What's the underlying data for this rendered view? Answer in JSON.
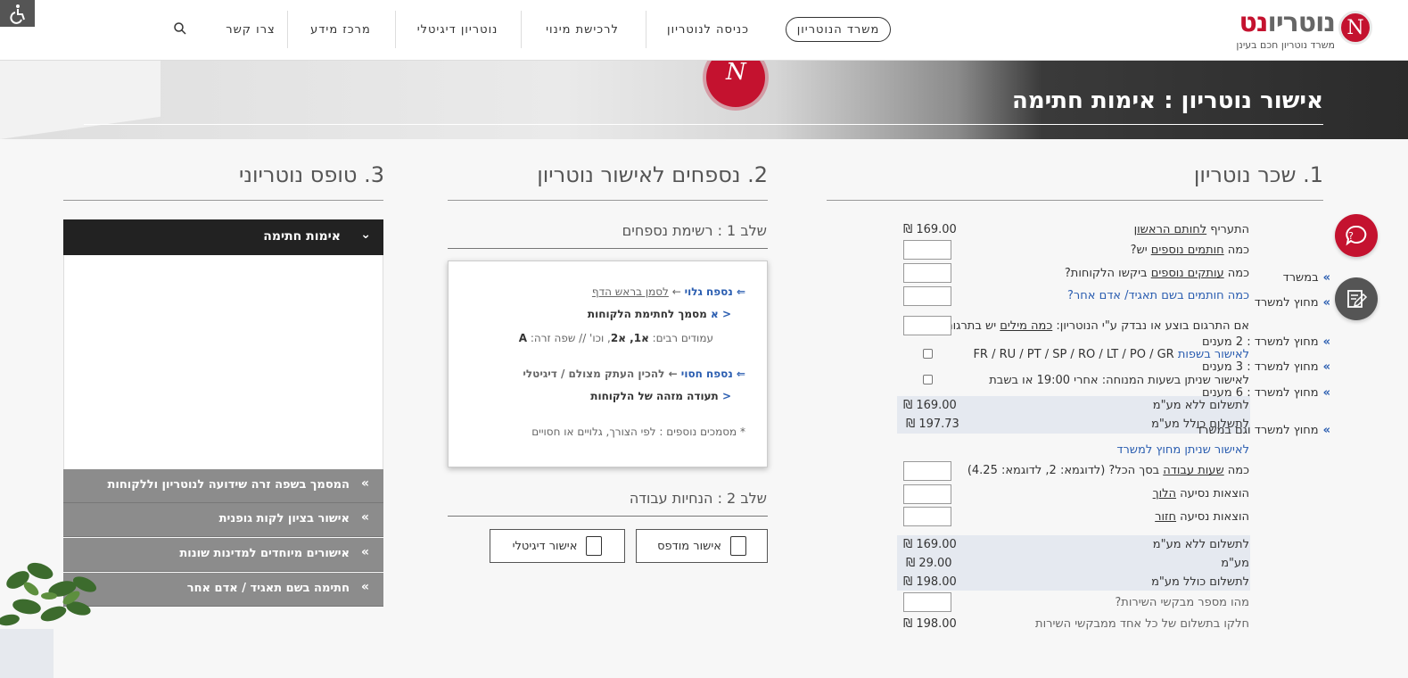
{
  "header": {
    "logo_main": "נוטריו",
    "logo_accent": "נט",
    "logo_sub": "משרד נוטריון חכם בעינן",
    "office_button": "משרד הנוטריון",
    "nav": [
      "כניסה לנוטריון",
      "לרכישת מינוי",
      "נוטריון דיגיטלי",
      "מרכז מידע",
      "צרו קשר"
    ]
  },
  "banner": {
    "title": "אישור נוטריון : אימות חתימה"
  },
  "col1": {
    "title": "1. שכר נוטריון",
    "rows": {
      "first_a": "התעריף ",
      "first_u": "לחותם הראשון",
      "first_val": "169.00 ₪",
      "signers_a": "כמה ",
      "signers_u": "חותמים נוספים",
      "signers_b": " יש?",
      "copies_a": "כמה ",
      "copies_u": "עותקים נוספים",
      "copies_b": " ביקשו הלקוחות?",
      "corp": "כמה חותמים בשם תאגיד/ אדם אחר?",
      "transl_a": "אם התרגום בוצע או נבדק ע\"י הנוטריון: ",
      "transl_u": "כמה מילים",
      "transl_b": " יש בתרגום?",
      "lang_a": "לאישור בשפות ",
      "lang_b": "FR / RU / PT / SP / RO / LT / PO / GR",
      "offhours": "לאישור שניתן בשעות המנוחה: אחרי 19:00 או בשבת",
      "pay_no_vat_1": "לתשלום ללא מע\"מ",
      "pay_no_vat_1_val": "169.00 ₪",
      "pay_vat_1": "לתשלום כולל מע\"מ",
      "pay_vat_1_val": "197.73 ₪",
      "outside": "לאישור שניתן מחוץ למשרד",
      "hours_a": "כמה ",
      "hours_u": "שעות עבודה",
      "hours_b": " בסך הכל? (לדוגמא: 2, לדוגמא: 4.25)",
      "travel_go_a": "הוצאות נסיעה ",
      "travel_go_u": "הלוך",
      "travel_back_a": "הוצאות נסיעה ",
      "travel_back_u": "חזור",
      "pay_no_vat_2": "לתשלום ללא מע\"מ",
      "pay_no_vat_2_val": "169.00 ₪",
      "vat": "מע\"מ",
      "vat_val": "29.00 ₪",
      "pay_vat_2": "לתשלום כולל מע\"מ",
      "pay_vat_2_val": "198.00 ₪",
      "requesters": "מהו מספר מבקשי השירות?",
      "split": "חלקו בתשלום של כל אחד ממבקשי השירות",
      "split_val": "198.00 ₪"
    }
  },
  "col2": {
    "title": "2. נספחים לאישור נוטריון",
    "step1": "שלב 1 : רשימת נספחים",
    "card": {
      "l1_a": "⇐ נספח גלוי",
      "l1_b": " ← ",
      "l1_c": "לסמן בראש הדף",
      "l2_a": "< א",
      "l2_b": " מסמך לחתימת הלקוחות",
      "l3": "עמודים רבים: ",
      "l3_b": "א1, א2",
      "l3_c": ", וכו' // שפה זרה: ",
      "l3_d": "A",
      "l4_a": "⇐ נספח חסוי",
      "l4_b": " ← להכין העתק מצולם / דיגיטלי",
      "l5_a": "<",
      "l5_b": " תעודה מזהה של הלקוחות",
      "l6": "* מסמכים נוספים : לפי הצורך, גלויים או חסויים"
    },
    "step2": "שלב 2 : הנחיות עבודה",
    "btn_printed": "אישור מודפס",
    "btn_digital": "אישור דיגיטלי"
  },
  "col3": {
    "title": "3. טופס נוטריוני",
    "accordion_open": "אימות חתימה",
    "items": [
      "במשרד",
      "מחוץ למשרד",
      "מחוץ למשרד : 2 מענים",
      "מחוץ למשרד : 3 מענים",
      "מחוץ למשרד : 6 מענים",
      "מחוץ למשרד וגם במשרד"
    ],
    "closed": [
      "המסמך בשפה זרה שידועה לנוטריון וללקוחות",
      "אישור בציון לקות גופנית",
      "אישורים מיוחדים למדינות שונות",
      "חתימה בשם תאגיד / אדם אחר"
    ]
  },
  "colors": {
    "brand_red": "#c4122f",
    "link_blue": "#2a5db0",
    "dark": "#222222"
  },
  "icons": [
    "accessibility-icon",
    "search-icon",
    "chat-icon",
    "form-icon"
  ]
}
